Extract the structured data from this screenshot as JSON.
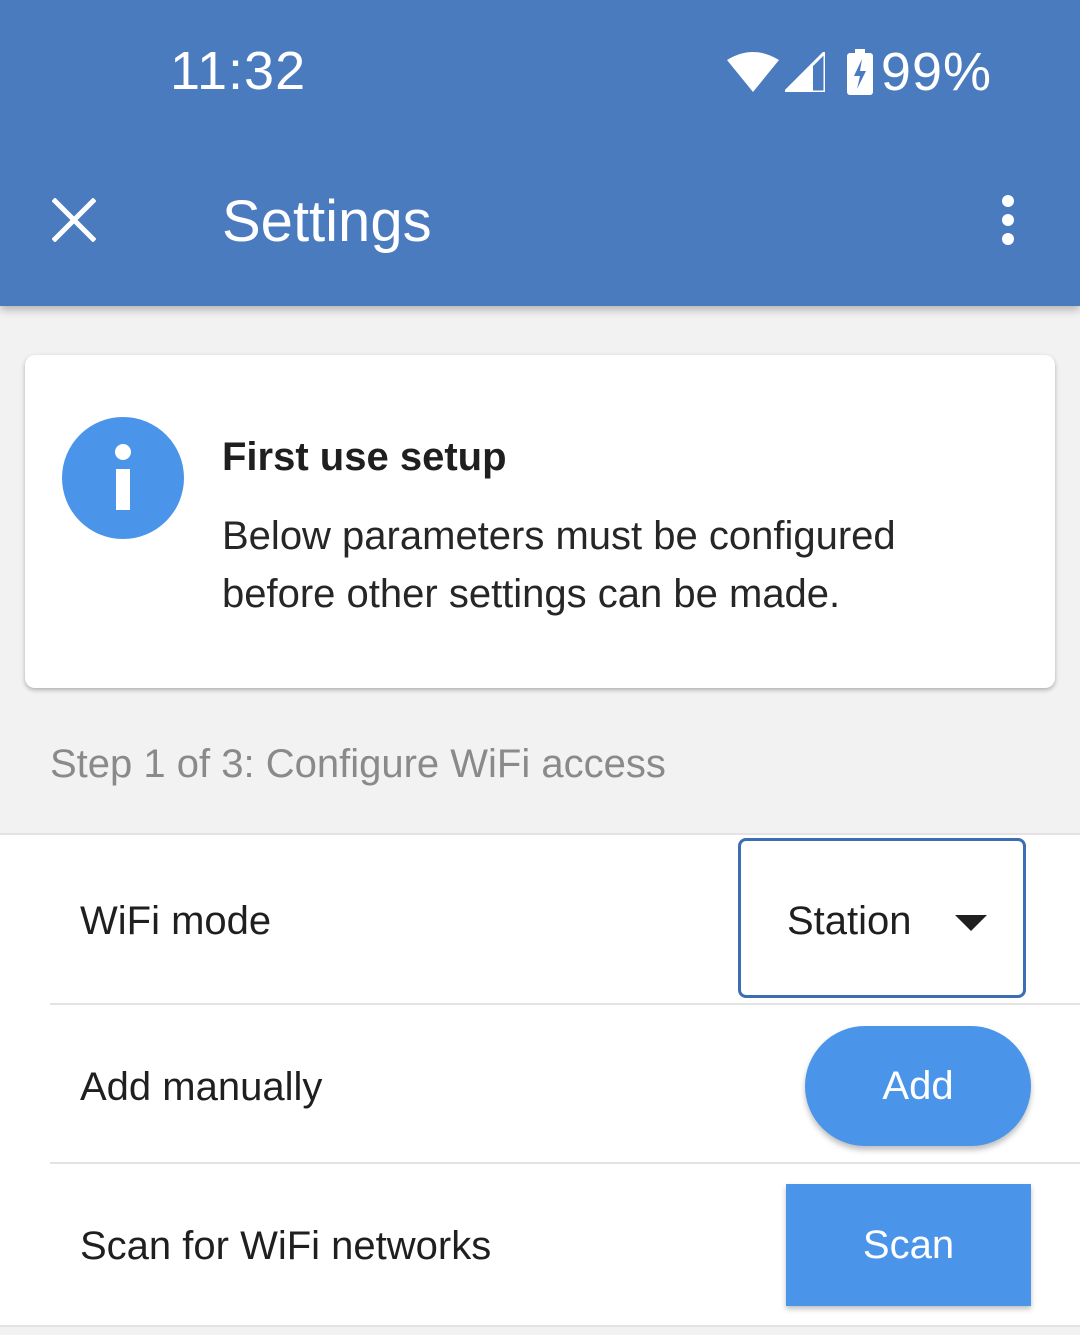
{
  "status_bar": {
    "time": "11:32",
    "battery_percent": "99%",
    "icons": [
      "wifi-icon",
      "cell-signal-icon",
      "battery-charging-icon"
    ]
  },
  "app_bar": {
    "title": "Settings",
    "close_icon": "close-icon",
    "menu_icon": "more-vert-icon",
    "background_color": "#4b7bbf"
  },
  "info_card": {
    "icon": "info-icon",
    "icon_color": "#4a95e9",
    "title": "First use setup",
    "body": "Below parameters must be configured before other settings can be made."
  },
  "step": {
    "label": "Step 1 of 3: Configure WiFi access"
  },
  "settings": {
    "wifi_mode": {
      "label": "WiFi mode",
      "selected_value": "Station",
      "dropdown_icon": "caret-down-icon"
    },
    "add_manually": {
      "label": "Add manually",
      "button_label": "Add"
    },
    "scan": {
      "label": "Scan for WiFi networks",
      "button_label": "Scan"
    }
  },
  "colors": {
    "accent": "#4a95e9",
    "focus_border": "#3d6db2",
    "page_background": "#f2f2f2"
  }
}
